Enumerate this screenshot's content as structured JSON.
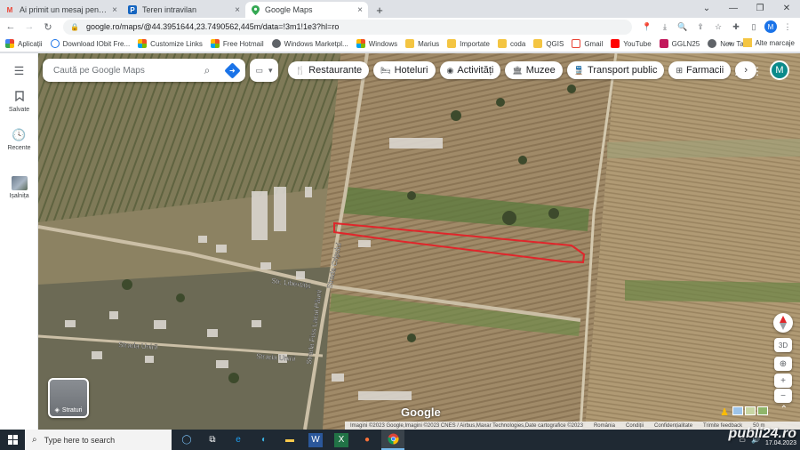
{
  "browser": {
    "tabs": [
      {
        "title": "Ai primit un mesaj pentru anuntul...",
        "icon": "gmail-icon",
        "active": false
      },
      {
        "title": "Teren intravilan",
        "icon": "publi24-icon",
        "active": false
      },
      {
        "title": "Google Maps",
        "icon": "maps-icon",
        "active": true
      }
    ],
    "new_tab_glyph": "+",
    "url": "google.ro/maps/@44.3951644,23.7490562,445m/data=!3m1!1e3?hl=ro",
    "bookmarks": [
      "Aplicații",
      "Download IObit Fre...",
      "Customize Links",
      "Free Hotmail",
      "Windows Marketpl...",
      "Windows",
      "Marius",
      "Importate",
      "coda",
      "QGIS",
      "Gmail",
      "YouTube",
      "GGLN25",
      "New Tab"
    ],
    "bookmarks_more": "»",
    "bookmarks_other": "Alte marcaje",
    "profile_letter": "M"
  },
  "maps": {
    "search_placeholder": "Caută pe Google Maps",
    "rail": [
      {
        "label": "Salvate",
        "icon": "bookmark-icon"
      },
      {
        "label": "Recente",
        "icon": "history-icon"
      },
      {
        "label": "Ișalnița",
        "icon": "place-thumbnail"
      }
    ],
    "chips": [
      {
        "label": "Restaurante",
        "icon": "restaurant-icon",
        "glyph": "🍴"
      },
      {
        "label": "Hoteluri",
        "icon": "hotel-icon",
        "glyph": "🛏"
      },
      {
        "label": "Activități",
        "icon": "camera-icon",
        "glyph": "◉"
      },
      {
        "label": "Muzee",
        "icon": "museum-icon",
        "glyph": "🏛"
      },
      {
        "label": "Transport public",
        "icon": "train-icon",
        "glyph": "🚆"
      },
      {
        "label": "Farmacii",
        "icon": "pharmacy-icon",
        "glyph": "⊞"
      }
    ],
    "chips_more_glyph": "›",
    "account_letter": "M",
    "layers_label": "Straturi",
    "streets": [
      "Strada Unirii",
      "Str. Libertății",
      "Strada Crișului",
      "Strada Fiss Lacul Păuni",
      "Strada Unirii"
    ],
    "controls": {
      "view_3d": "3D",
      "zoom_in": "+",
      "zoom_out": "−"
    },
    "logo": "Google",
    "attribution": [
      "Imagini ©2023 Google,Imagini ©2023 CNES / Airbus,Maxar Technologies,Date cartografice ©2023",
      "România",
      "Condiții",
      "Confidențialitate",
      "Trimite feedback",
      "50 m"
    ],
    "colors": {
      "highlight": "#e0262b",
      "accent": "#1a73e8"
    }
  },
  "taskbar": {
    "search_placeholder": "Type here to search",
    "apps": [
      "cortana-icon",
      "task-view-icon",
      "ie-icon",
      "edge-icon",
      "file-explorer-icon",
      "word-icon",
      "excel-icon",
      "firefox-icon",
      "chrome-icon"
    ],
    "date": "17.04.2023"
  },
  "watermark": "publi24.ro"
}
